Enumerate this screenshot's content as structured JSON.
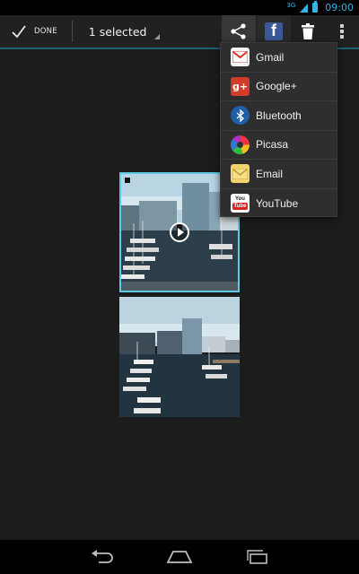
{
  "status_bar": {
    "network_label": "3G",
    "time": "09:00",
    "colors": {
      "accent": "#33b5e5"
    },
    "icons": [
      "signal-icon",
      "battery-icon"
    ]
  },
  "action_bar": {
    "done_label": "DONE",
    "selection_label": "1 selected",
    "actions": [
      {
        "name": "share",
        "icon": "share-icon"
      },
      {
        "name": "facebook",
        "icon": "facebook-icon"
      },
      {
        "name": "delete",
        "icon": "trash-icon"
      },
      {
        "name": "overflow",
        "icon": "overflow-menu-icon"
      }
    ]
  },
  "share_menu": {
    "items": [
      {
        "label": "Gmail",
        "icon": "gmail-icon"
      },
      {
        "label": "Google+",
        "icon": "google-plus-icon"
      },
      {
        "label": "Bluetooth",
        "icon": "bluetooth-icon"
      },
      {
        "label": "Picasa",
        "icon": "picasa-icon"
      },
      {
        "label": "Email",
        "icon": "email-icon"
      },
      {
        "label": "YouTube",
        "icon": "youtube-icon"
      }
    ]
  },
  "gallery": {
    "items": [
      {
        "type": "video",
        "selected": true,
        "description": "harbor-marina-video"
      },
      {
        "type": "photo",
        "selected": false,
        "description": "harbor-marina-photo"
      }
    ],
    "selection_color": "#5ec9e0"
  },
  "nav_bar": {
    "buttons": [
      "back-icon",
      "home-icon",
      "recent-apps-icon"
    ]
  }
}
